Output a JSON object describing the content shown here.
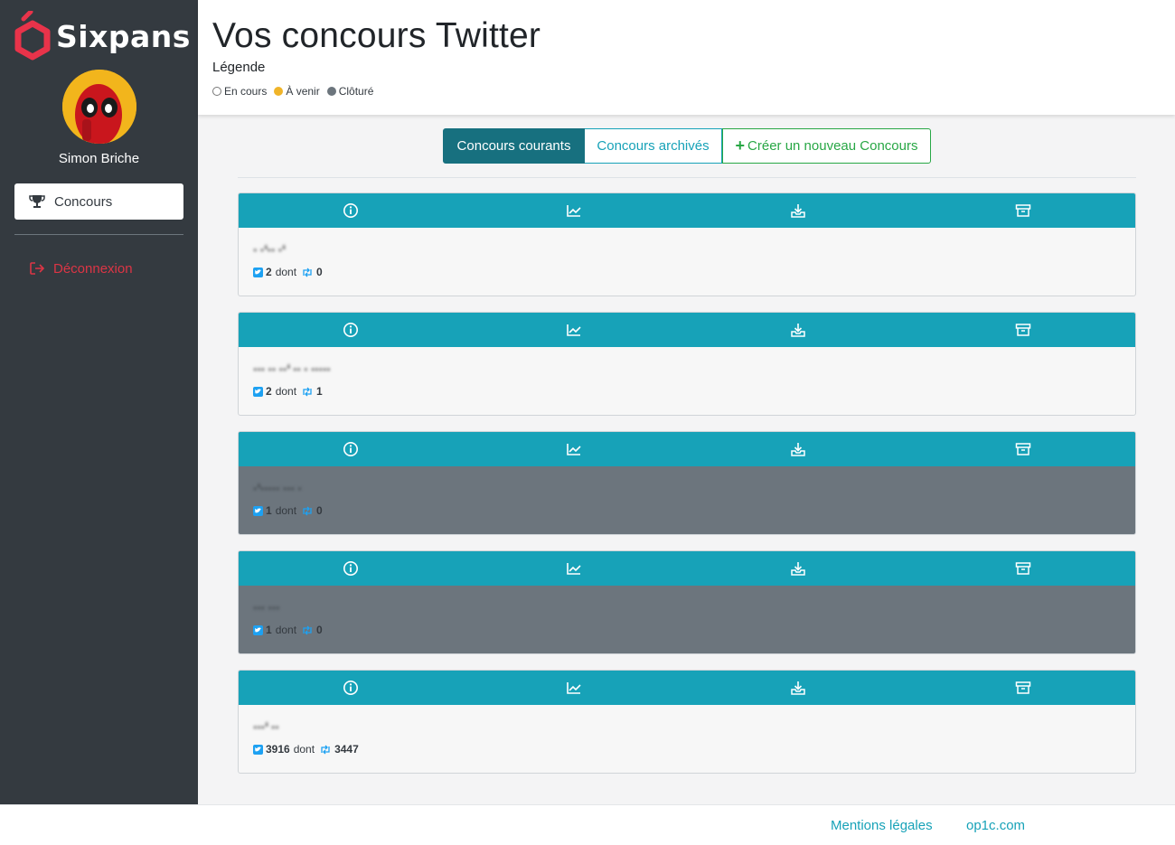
{
  "brand": {
    "name": "Sixpans",
    "accent": "#e8334a"
  },
  "user": {
    "name": "Simon Briche"
  },
  "sidebar": {
    "concours_label": "Concours",
    "logout_label": "Déconnexion"
  },
  "header": {
    "title": "Vos concours Twitter",
    "legend_title": "Légende",
    "legend": [
      {
        "label": "En cours",
        "color": "#ffffff"
      },
      {
        "label": "À venir",
        "color": "#f0b429"
      },
      {
        "label": "Clôturé",
        "color": "#6c757d"
      }
    ]
  },
  "tabs": {
    "current": "Concours courants",
    "archived": "Concours archivés",
    "create": "Créer un nouveau Concours"
  },
  "cards": [
    {
      "title": "· ·ʻ·· ·ʻ",
      "count": "2",
      "dont": "dont",
      "retweets": "0",
      "status": "en cours"
    },
    {
      "title": "··· ·· ··ʻ ·· · ·····",
      "count": "2",
      "dont": "dont",
      "retweets": "1",
      "status": "en cours"
    },
    {
      "title": "·ʻ····· ··· ·",
      "count": "1",
      "dont": "dont",
      "retweets": "0",
      "status": "clôturé"
    },
    {
      "title": "··· ···",
      "count": "1",
      "dont": "dont",
      "retweets": "0",
      "status": "clôturé"
    },
    {
      "title": "···ʻ ··",
      "count": "3916",
      "dont": "dont",
      "retweets": "3447",
      "status": "en cours"
    }
  ],
  "footer": {
    "legal": "Mentions légales",
    "site": "op1c.com"
  }
}
